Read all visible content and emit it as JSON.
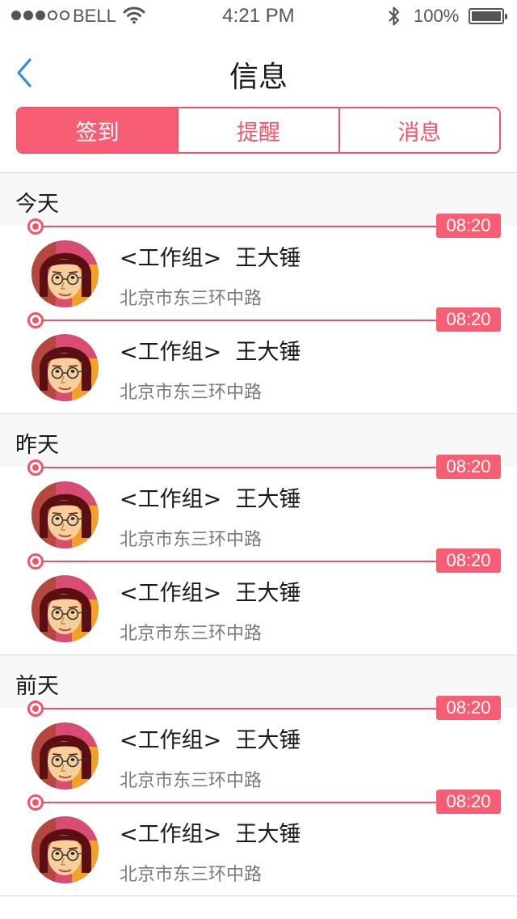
{
  "status_bar": {
    "carrier": "BELL",
    "time": "4:21 PM",
    "battery": "100%"
  },
  "nav": {
    "title": "信息",
    "back_icon": "chevron-left-icon"
  },
  "segments": [
    {
      "label": "签到",
      "active": true
    },
    {
      "label": "提醒",
      "active": false
    },
    {
      "label": "消息",
      "active": false
    }
  ],
  "colors": {
    "accent": "#f75d73",
    "accent_border": "#f2546b",
    "back_icon": "#2f8de4"
  },
  "groups": [
    {
      "title": "今天",
      "entries": [
        {
          "time": "08:20",
          "title": "<工作组>  王大锤",
          "subtitle": "北京市东三环中路"
        },
        {
          "time": "08:20",
          "title": "<工作组>  王大锤",
          "subtitle": "北京市东三环中路"
        }
      ]
    },
    {
      "title": "昨天",
      "entries": [
        {
          "time": "08:20",
          "title": "<工作组>  王大锤",
          "subtitle": "北京市东三环中路"
        },
        {
          "time": "08:20",
          "title": "<工作组>  王大锤",
          "subtitle": "北京市东三环中路"
        }
      ]
    },
    {
      "title": "前天",
      "entries": [
        {
          "time": "08:20",
          "title": "<工作组>  王大锤",
          "subtitle": "北京市东三环中路"
        },
        {
          "time": "08:20",
          "title": "<工作组>  王大锤",
          "subtitle": "北京市东三环中路"
        }
      ]
    }
  ]
}
